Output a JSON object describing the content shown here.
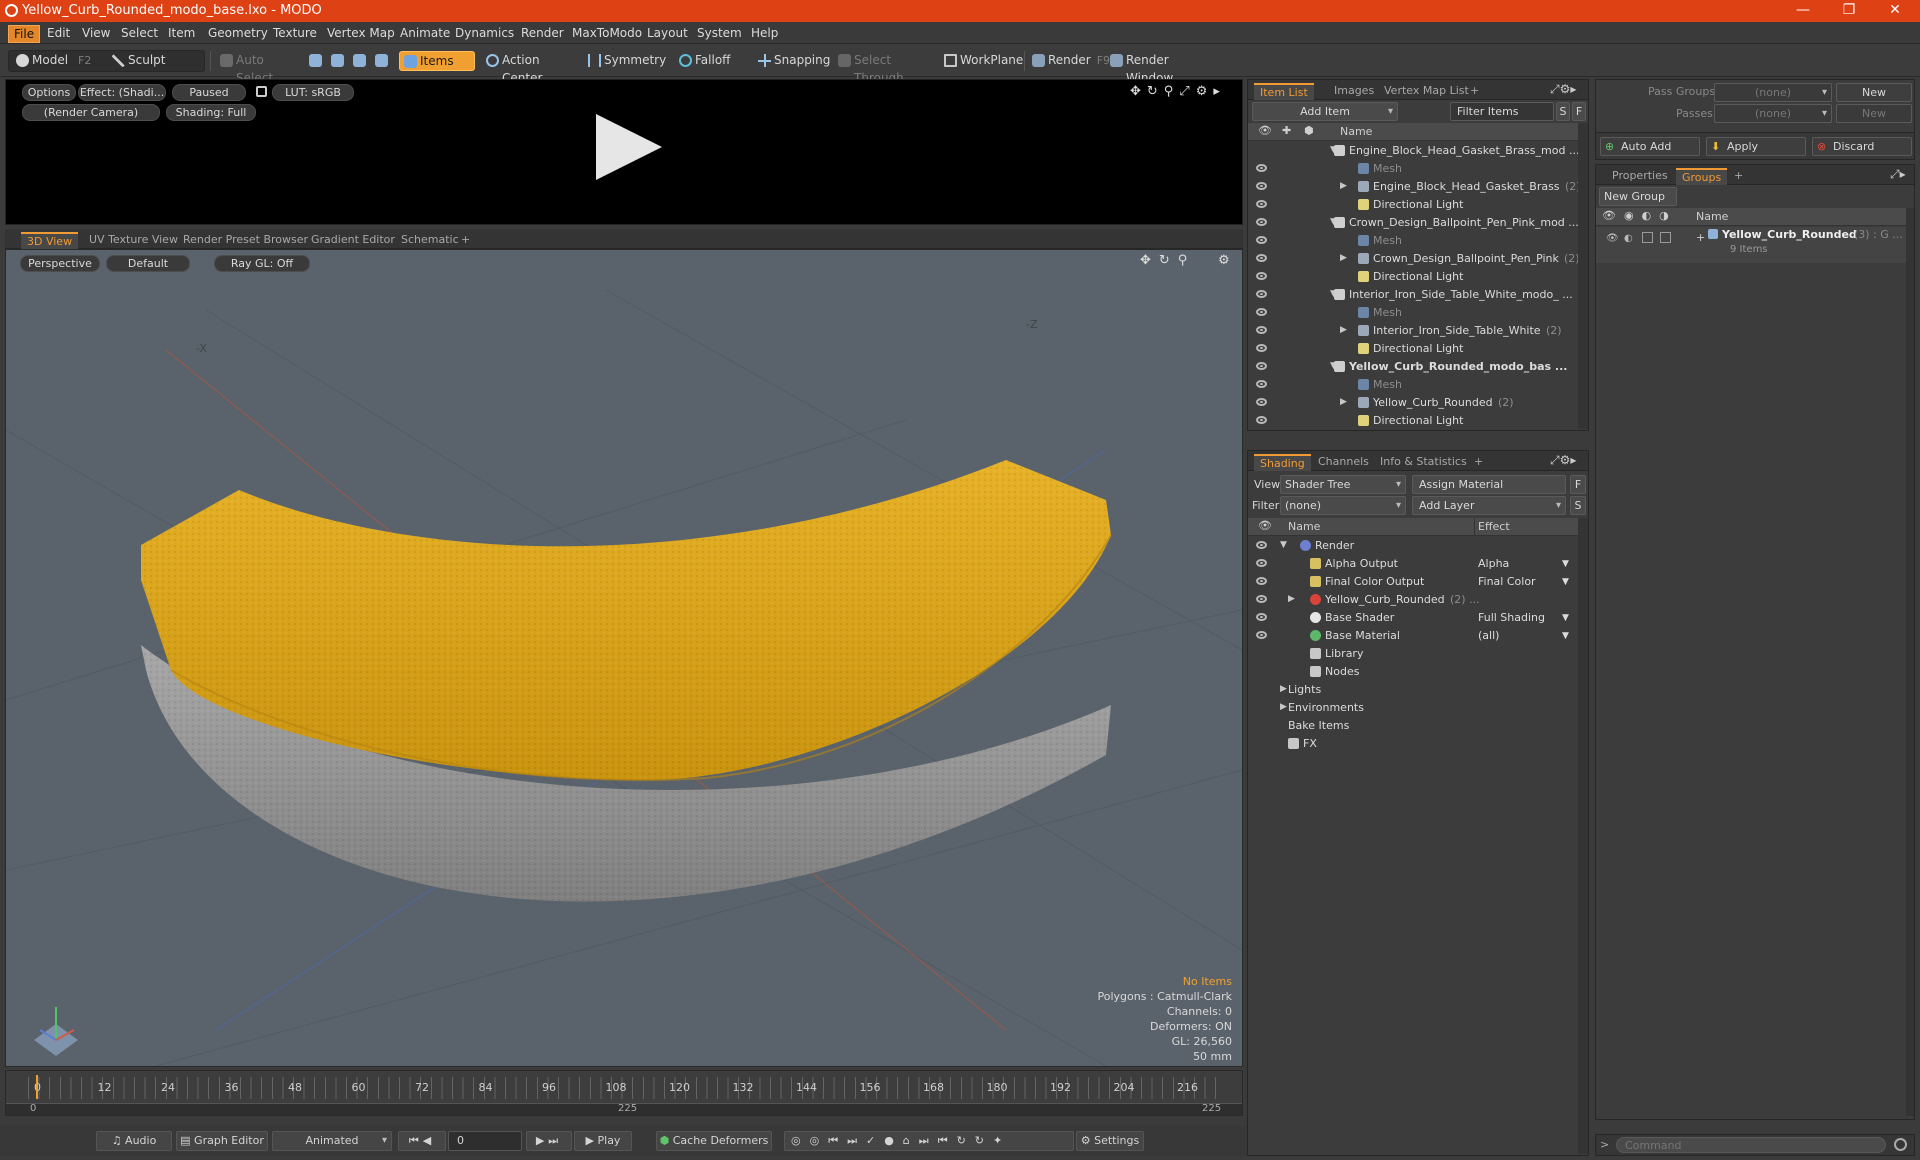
{
  "window": {
    "title": "Yellow_Curb_Rounded_modo_base.lxo - MODO",
    "min": "—",
    "max": "❐",
    "close": "✕"
  },
  "menu": [
    "File",
    "Edit",
    "View",
    "Select",
    "Item",
    "Geometry",
    "Texture",
    "Vertex Map",
    "Animate",
    "Dynamics",
    "Render",
    "MaxToModo",
    "Layout",
    "System",
    "Help"
  ],
  "toolbar": {
    "model": "Model",
    "model_key": "F2",
    "sculpt": "Sculpt",
    "auto_select": "Auto Select",
    "items": "Items",
    "action_center": "Action Center",
    "symmetry": "Symmetry",
    "falloff": "Falloff",
    "snapping": "Snapping",
    "select_through": "Select Through",
    "workplane": "WorkPlane",
    "render": "Render",
    "render_key": "F9",
    "render_window": "Render Window"
  },
  "preview": {
    "options": "Options",
    "effect": "Effect: (Shadi...",
    "paused": "Paused",
    "lut": "LUT: sRGB",
    "camera": "(Render Camera)",
    "shading": "Shading: Full"
  },
  "viewport_tabs": [
    "3D View",
    "UV Texture View",
    "Render Preset Browser",
    "Gradient Editor",
    "Schematic",
    "+"
  ],
  "viewport": {
    "perspective": "Perspective",
    "default": "Default",
    "raygl": "Ray GL: Off",
    "axis_x": "-X",
    "axis_z": "-Z",
    "info": {
      "no_items": "No Items",
      "polygons": "Polygons : Catmull-Clark",
      "channels": "Channels: 0",
      "deformers": "Deformers: ON",
      "gl": "GL: 26,560",
      "size": "50 mm"
    },
    "colors": {
      "curb_top": "#e0a81c",
      "curb_side": "#9a9a9a",
      "background": "#5a636b"
    }
  },
  "timeline": {
    "ticks": [
      "0",
      "12",
      "24",
      "36",
      "48",
      "60",
      "72",
      "84",
      "96",
      "108",
      "120",
      "132",
      "144",
      "156",
      "168",
      "180",
      "192",
      "204",
      "216"
    ],
    "bottom_start": "0",
    "bottom_mid": "225",
    "bottom_end": "225"
  },
  "transport": {
    "audio": "Audio",
    "graph_editor": "Graph Editor",
    "animated": "Animated",
    "frame": "0",
    "play": "Play",
    "cache": "Cache Deformers",
    "settings": "Settings"
  },
  "item_list": {
    "tabs": [
      "Item List",
      "Images",
      "Vertex Map List",
      "+"
    ],
    "add_item": "Add Item",
    "filter": "Filter Items",
    "s": "S",
    "f": "F",
    "col_name": "Name",
    "rows": [
      {
        "label": "Engine_Block_Head_Gasket_Brass_mod ...",
        "type": "scene",
        "indent": 0,
        "bold": false
      },
      {
        "label": "Mesh",
        "type": "mesh",
        "indent": 1,
        "gray": true
      },
      {
        "label": "Engine_Block_Head_Gasket_Brass",
        "count": "(2)",
        "type": "group",
        "indent": 1
      },
      {
        "label": "Directional Light",
        "type": "light",
        "indent": 1
      },
      {
        "label": "Crown_Design_Ballpoint_Pen_Pink_mod ...",
        "type": "scene",
        "indent": 0
      },
      {
        "label": "Mesh",
        "type": "mesh",
        "indent": 1,
        "gray": true
      },
      {
        "label": "Crown_Design_Ballpoint_Pen_Pink",
        "count": "(2)",
        "type": "group",
        "indent": 1
      },
      {
        "label": "Directional Light",
        "type": "light",
        "indent": 1
      },
      {
        "label": "Interior_Iron_Side_Table_White_modo_ ...",
        "type": "scene",
        "indent": 0
      },
      {
        "label": "Mesh",
        "type": "mesh",
        "indent": 1,
        "gray": true
      },
      {
        "label": "Interior_Iron_Side_Table_White",
        "count": "(2)",
        "type": "group",
        "indent": 1
      },
      {
        "label": "Directional Light",
        "type": "light",
        "indent": 1
      },
      {
        "label": "Yellow_Curb_Rounded_modo_bas ...",
        "type": "scene",
        "indent": 0,
        "bold": true
      },
      {
        "label": "Mesh",
        "type": "mesh",
        "indent": 1,
        "gray": true
      },
      {
        "label": "Yellow_Curb_Rounded",
        "count": "(2)",
        "type": "group",
        "indent": 1
      },
      {
        "label": "Directional Light",
        "type": "light",
        "indent": 1
      }
    ]
  },
  "shading": {
    "tabs": [
      "Shading",
      "Channels",
      "Info & Statistics",
      "+"
    ],
    "view_label": "View",
    "view_value": "Shader Tree",
    "assign": "Assign Material",
    "filter_label": "Filter",
    "filter_value": "(none)",
    "add_layer": "Add Layer",
    "f": "F",
    "s": "S",
    "col_name": "Name",
    "col_effect": "Effect",
    "rows": [
      {
        "label": "Render",
        "effect": "",
        "indent": 0,
        "icon": "render"
      },
      {
        "label": "Alpha Output",
        "effect": "Alpha",
        "indent": 1,
        "icon": "output"
      },
      {
        "label": "Final Color Output",
        "effect": "Final Color",
        "indent": 1,
        "icon": "output"
      },
      {
        "label": "Yellow_Curb_Rounded",
        "count": "(2) ...",
        "effect": "",
        "indent": 1,
        "icon": "material"
      },
      {
        "label": "Base Shader",
        "effect": "Full Shading",
        "indent": 1,
        "icon": "shader"
      },
      {
        "label": "Base Material",
        "effect": "(all)",
        "indent": 1,
        "icon": "basemat"
      },
      {
        "label": "Library",
        "effect": "",
        "indent": 1,
        "icon": "folder"
      },
      {
        "label": "Nodes",
        "effect": "",
        "indent": 1,
        "icon": "folder"
      },
      {
        "label": "Lights",
        "effect": "",
        "indent": 0,
        "icon": "none"
      },
      {
        "label": "Environments",
        "effect": "",
        "indent": 0,
        "icon": "none"
      },
      {
        "label": "Bake Items",
        "effect": "",
        "indent": 0,
        "icon": "none"
      },
      {
        "label": "FX",
        "effect": "",
        "indent": 0,
        "icon": "fx"
      }
    ]
  },
  "passes": {
    "pass_groups": "Pass Groups",
    "passes": "Passes",
    "none": "(none)",
    "new": "New",
    "auto_add": "Auto Add",
    "apply": "Apply",
    "discard": "Discard"
  },
  "groups": {
    "tabs": [
      "Properties",
      "Groups",
      "+"
    ],
    "new_group": "New Group",
    "col_name": "Name",
    "item": "Yellow_Curb_Rounded",
    "item_suffix": "(3) : G ...",
    "item_count": "9 Items"
  },
  "command": {
    "placeholder": "Command"
  }
}
